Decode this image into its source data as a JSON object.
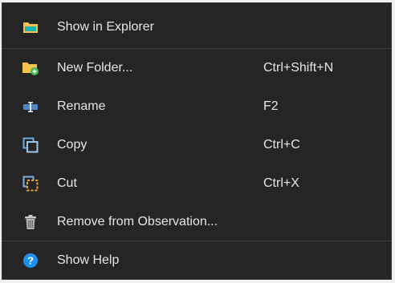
{
  "context_menu": {
    "items": [
      {
        "label": "Show in Explorer",
        "shortcut": "",
        "icon": "folder-icon"
      },
      {
        "label": "New Folder...",
        "shortcut": "Ctrl+Shift+N",
        "icon": "new-folder-icon"
      },
      {
        "label": "Rename",
        "shortcut": "F2",
        "icon": "rename-icon"
      },
      {
        "label": "Copy",
        "shortcut": "Ctrl+C",
        "icon": "copy-icon"
      },
      {
        "label": "Cut",
        "shortcut": "Ctrl+X",
        "icon": "cut-icon"
      },
      {
        "label": "Remove from Observation...",
        "shortcut": "",
        "icon": "trash-icon"
      },
      {
        "label": "Show Help",
        "shortcut": "",
        "icon": "help-icon"
      }
    ]
  },
  "colors": {
    "background": "#252526",
    "text": "#e6e6e6",
    "separator": "#3f3f46",
    "folder_yellow": "#f5c24c",
    "folder_tab_teal": "#1fb5b5",
    "add_green": "#3fb950",
    "help_blue": "#1e8ef0",
    "copy_blue": "#6fa8dc",
    "cut_orange": "#e8a33d"
  }
}
